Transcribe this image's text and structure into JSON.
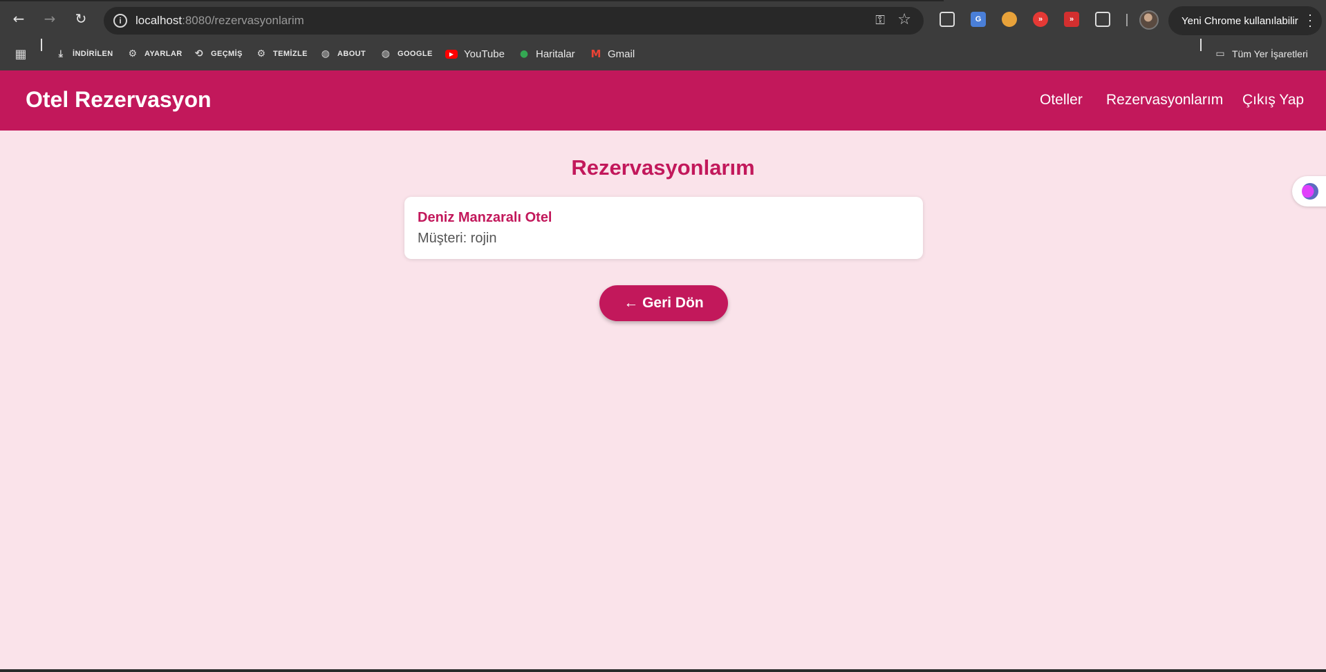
{
  "browser": {
    "url_host": "localhost",
    "url_path": ":8080/rezervasyonlarim",
    "profile_pill": "Yeni Chrome kullanılabilir",
    "bookmarks": [
      {
        "label": "İNDİRİLEN",
        "icon": "download-icon"
      },
      {
        "label": "AYARLAR",
        "icon": "gear-icon"
      },
      {
        "label": "GEÇMİŞ",
        "icon": "history-icon"
      },
      {
        "label": "TEMİZLE",
        "icon": "gear-icon"
      },
      {
        "label": "ABOUT",
        "icon": "globe-icon"
      },
      {
        "label": "GOOGLE",
        "icon": "globe-icon"
      },
      {
        "label": "YouTube",
        "icon": "youtube-icon"
      },
      {
        "label": "Haritalar",
        "icon": "maps-icon"
      },
      {
        "label": "Gmail",
        "icon": "gmail-icon"
      }
    ],
    "all_bookmarks": "Tüm Yer İşaretleri"
  },
  "navbar": {
    "brand": "Otel Rezervasyon",
    "links": [
      "Oteller",
      "Rezervasyonlarım",
      "Çıkış Yap"
    ]
  },
  "main": {
    "title": "Rezervasyonlarım",
    "reservations": [
      {
        "hotel": "Deniz Manzaralı Otel",
        "customer": "Müşteri: rojin"
      }
    ],
    "back_button": "← Geri Dön"
  },
  "colors": {
    "primary": "#c2185b",
    "background": "#fae3ea"
  }
}
